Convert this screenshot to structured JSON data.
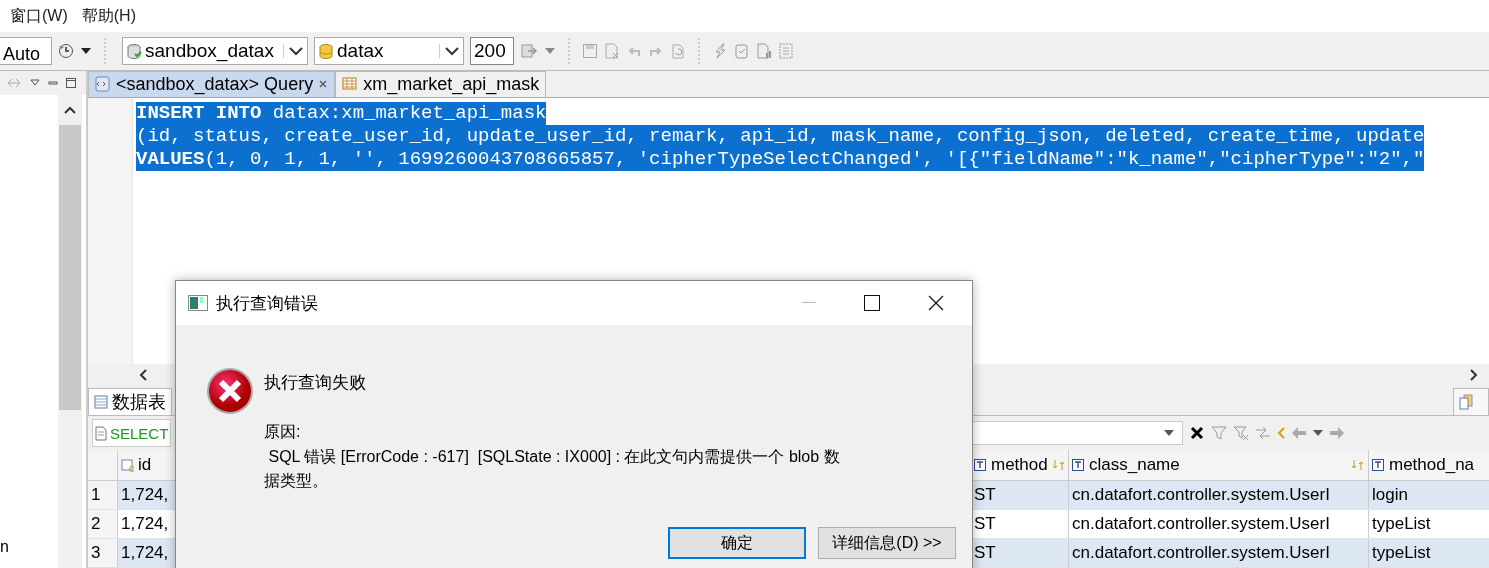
{
  "menu": [
    {
      "label": "窗口(W)"
    },
    {
      "label": "帮助(H)"
    }
  ],
  "toolbar": {
    "auto_combo": "Auto",
    "connection_combo": "sandbox_datax",
    "database_combo": "datax",
    "limit_field": "200"
  },
  "left_panel": {
    "text": "n"
  },
  "editor_tabs": [
    {
      "kind": "query",
      "label": "<sandbox_datax> Query",
      "selected": true
    },
    {
      "kind": "table",
      "label": "xm_market_api_mask",
      "selected": false
    }
  ],
  "editor": {
    "lines": [
      {
        "text": "**INSERT INTO** datax:xm_market_api_mask",
        "selected": true
      },
      {
        "text": "(id, status, create_user_id, update_user_id, remark, api_id, mask_name, config_json, deleted, create_time, update",
        "selected": true
      },
      {
        "text": "**VALUES**(1, 0, 1, 1, '', 1699260043708665857, 'cipherTypeSelectChanged', '[{\"fieldName\":\"k_name\",\"cipherType\":\"2\",\"",
        "selected": true
      }
    ]
  },
  "result_tabs": [
    {
      "label": "数据表",
      "selected": true
    }
  ],
  "filter": {
    "sql_text": "SELECT"
  },
  "grid": {
    "columns": [
      {
        "label": "id",
        "kind": "key"
      },
      {
        "label": "method",
        "kind": "text"
      },
      {
        "label": "class_name",
        "kind": "text"
      },
      {
        "label": "method_na",
        "kind": "text"
      }
    ],
    "rows": [
      {
        "number": "1",
        "cells": [
          "1,724,",
          "ST",
          "cn.datafort.controller.system.UserI",
          "login"
        ]
      },
      {
        "number": "2",
        "cells": [
          "1,724,",
          "ST",
          "cn.datafort.controller.system.UserI",
          "typeList"
        ]
      },
      {
        "number": "3",
        "cells": [
          "1,724,",
          "ST",
          "cn.datafort.controller.system.UserI",
          "typeList"
        ]
      }
    ]
  },
  "dialog": {
    "title": "执行查询错误",
    "heading": "执行查询失败",
    "reason_label": "原因:",
    "message": " SQL 错误 [ErrorCode : -617]  [SQLState : IX000] : 在此文句内需提供一个 blob 数据类型。",
    "buttons": [
      {
        "label": "确定",
        "focused": true
      },
      {
        "label": "详细信息(D) >>",
        "focused": false
      }
    ]
  }
}
